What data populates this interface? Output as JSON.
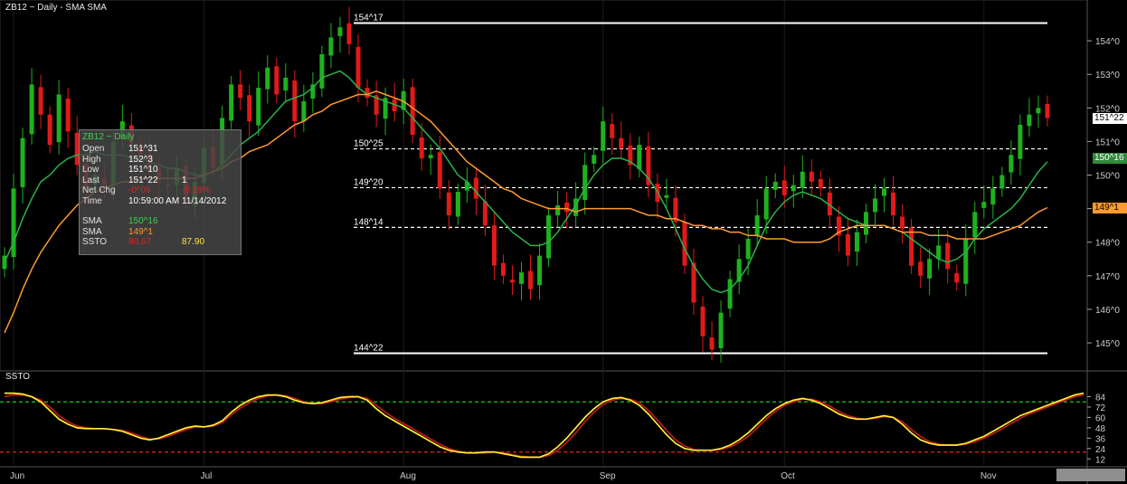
{
  "header": {
    "title": "ZB12 ~ Daily  -  SMA SMA"
  },
  "info_panel": {
    "header": "ZB12 ~ Daily",
    "rows": [
      {
        "label": "Open",
        "value": "151^31",
        "value2": ""
      },
      {
        "label": "High",
        "value": "152^3",
        "value2": ""
      },
      {
        "label": "Low",
        "value": "151^10",
        "value2": ""
      },
      {
        "label": "Last",
        "value": "151^22",
        "value2": "1"
      },
      {
        "label": "Net Chg",
        "value": "-0^09",
        "value2": "-0.19%"
      },
      {
        "label": "Time",
        "value": "10:59:00 AM",
        "value2": "11/14/2012"
      }
    ],
    "indicators": [
      {
        "label": "SMA",
        "value": "150^16",
        "value2": "",
        "color": "#3fd14f"
      },
      {
        "label": "SMA",
        "value": "149^1",
        "value2": "",
        "color": "#ff9a2e"
      },
      {
        "label": "SSTO",
        "value": "80.67",
        "value2": "87.90",
        "color": "#e02020",
        "color2": "#ffe14a"
      }
    ]
  },
  "price_badges": [
    {
      "text": "151^22",
      "bg": "#ffffff",
      "fg": "#000000",
      "value": 151.6875
    },
    {
      "text": "150^16",
      "bg": "#2e8b3a",
      "fg": "#ffffff",
      "value": 150.5
    },
    {
      "text": "149^1",
      "bg": "#ff9a2e",
      "fg": "#000000",
      "value": 149.03
    }
  ],
  "ssto_label": "SSTO",
  "colors": {
    "up": "#1db21d",
    "down": "#e01a1a",
    "sma_fast": "#2bb24a",
    "sma_slow": "#ff9a2e",
    "ssto_k": "#ffee33",
    "ssto_d": "#c01818",
    "upper_band": "#22dd22",
    "lower_band": "#dd2222"
  },
  "chart_data": [
    {
      "type": "candlestick",
      "title": "ZB12 ~ Daily  -  SMA SMA",
      "ylim": [
        144.3,
        155
      ],
      "y_ticks": [
        "145^0",
        "146^0",
        "147^0",
        "148^0",
        "149^0",
        "150^0",
        "151^0",
        "152^0",
        "153^0",
        "154^0"
      ],
      "x_labels": [
        {
          "label": "Jun",
          "index": 1
        },
        {
          "label": "Jul",
          "index": 22
        },
        {
          "label": "Aug",
          "index": 44
        },
        {
          "label": "Sep",
          "index": 66
        },
        {
          "label": "Oct",
          "index": 86
        },
        {
          "label": "Nov",
          "index": 108
        }
      ],
      "levels": [
        {
          "label": "154^17",
          "value": 154.53,
          "style": "solid",
          "x_start_index": 39
        },
        {
          "label": "150^25",
          "value": 150.78,
          "style": "dashed",
          "x_start_index": 39
        },
        {
          "label": "149^20",
          "value": 149.625,
          "style": "dashed",
          "x_start_index": 39
        },
        {
          "label": "148^14",
          "value": 148.44,
          "style": "dashed",
          "x_start_index": 39
        },
        {
          "label": "144^22",
          "value": 144.69,
          "style": "solid",
          "x_start_index": 39
        }
      ],
      "ohlc_close": [
        147.6,
        149.6,
        151.1,
        152.7,
        151.8,
        150.9,
        152.4,
        151.3,
        150.3,
        149.6,
        150.0,
        149.7,
        151.0,
        151.6,
        150.9,
        150.6,
        150.1,
        149.8,
        149.7,
        150.2,
        149.2,
        149.8,
        150.8,
        150.2,
        151.7,
        152.7,
        152.3,
        151.6,
        152.6,
        153.2,
        152.4,
        152.9,
        151.6,
        152.2,
        152.7,
        153.6,
        154.1,
        154.4,
        153.9,
        152.6,
        152.3,
        151.8,
        152.3,
        151.9,
        152.5,
        151.2,
        150.5,
        150.6,
        149.6,
        148.8,
        149.5,
        149.8,
        149.3,
        148.5,
        147.3,
        147.0,
        146.8,
        147.1,
        146.6,
        147.6,
        148.8,
        149.1,
        148.9,
        149.3,
        150.3,
        150.6,
        151.6,
        151.1,
        150.8,
        150.3,
        150.9,
        149.7,
        149.2,
        149.4,
        148.6,
        147.3,
        146.2,
        145.2,
        144.8,
        145.9,
        146.9,
        147.5,
        148.1,
        148.8,
        149.6,
        149.8,
        149.4,
        149.7,
        150.1,
        149.8,
        149.6,
        148.8,
        148.2,
        147.6,
        148.3,
        148.9,
        149.3,
        149.6,
        148.8,
        148.4,
        147.3,
        147.0,
        147.5,
        147.9,
        147.2,
        146.8,
        148.1,
        148.9,
        149.2,
        149.6,
        150.0,
        150.6,
        151.5,
        151.8,
        152.0,
        151.7
      ],
      "series": [
        {
          "name": "SMA",
          "values": [
            147.4,
            148.0,
            148.7,
            149.3,
            149.8,
            150.0,
            150.3,
            150.5,
            150.6,
            150.6,
            150.7,
            150.6,
            150.6,
            150.6,
            150.5,
            150.5,
            150.4,
            150.3,
            150.2,
            150.2,
            150.1,
            150.0,
            150.0,
            150.1,
            150.3,
            150.6,
            150.9,
            151.1,
            151.3,
            151.6,
            151.9,
            152.2,
            152.3,
            152.4,
            152.6,
            152.9,
            153.0,
            153.1,
            152.9,
            152.6,
            152.4,
            152.3,
            152.2,
            152.1,
            152.0,
            151.7,
            151.4,
            151.1,
            150.8,
            150.4,
            150.0,
            149.8,
            149.5,
            149.2,
            148.9,
            148.6,
            148.3,
            148.1,
            147.9,
            147.9,
            148.0,
            148.3,
            148.7,
            149.1,
            149.6,
            150.0,
            150.3,
            150.5,
            150.5,
            150.4,
            150.2,
            149.9,
            149.5,
            149.0,
            148.4,
            147.8,
            147.3,
            146.9,
            146.6,
            146.5,
            146.6,
            146.9,
            147.3,
            147.9,
            148.5,
            148.9,
            149.2,
            149.4,
            149.5,
            149.4,
            149.3,
            149.1,
            148.9,
            148.7,
            148.6,
            148.5,
            148.5,
            148.5,
            148.4,
            148.3,
            148.1,
            147.9,
            147.7,
            147.5,
            147.4,
            147.5,
            147.7,
            148.1,
            148.4,
            148.6,
            148.8,
            149.0,
            149.3,
            149.7,
            150.1,
            150.4
          ]
        },
        {
          "name": "SMA",
          "values": [
            145.3,
            145.9,
            146.6,
            147.2,
            147.7,
            148.1,
            148.5,
            148.8,
            149.1,
            149.3,
            149.5,
            149.6,
            149.7,
            149.8,
            149.8,
            149.9,
            149.9,
            149.9,
            149.9,
            149.9,
            149.9,
            149.9,
            150.0,
            150.1,
            150.2,
            150.4,
            150.5,
            150.7,
            150.8,
            150.9,
            151.1,
            151.3,
            151.5,
            151.6,
            151.8,
            151.9,
            152.1,
            152.2,
            152.3,
            152.4,
            152.4,
            152.5,
            152.4,
            152.3,
            152.2,
            152.0,
            151.8,
            151.6,
            151.3,
            151.0,
            150.7,
            150.4,
            150.2,
            150.0,
            149.8,
            149.6,
            149.5,
            149.3,
            149.2,
            149.1,
            149.0,
            149.0,
            149.0,
            148.9,
            149.0,
            149.0,
            149.0,
            149.0,
            149.0,
            149.0,
            148.9,
            148.8,
            148.8,
            148.7,
            148.7,
            148.6,
            148.5,
            148.5,
            148.4,
            148.4,
            148.3,
            148.3,
            148.2,
            148.2,
            148.1,
            148.1,
            148.1,
            148.0,
            148.0,
            148.0,
            148.0,
            148.1,
            148.3,
            148.4,
            148.5,
            148.5,
            148.5,
            148.5,
            148.4,
            148.3,
            148.3,
            148.3,
            148.2,
            148.2,
            148.2,
            148.1,
            148.1,
            148.1,
            148.1,
            148.2,
            148.3,
            148.4,
            148.5,
            148.7,
            148.9,
            149.03
          ]
        }
      ]
    },
    {
      "type": "line",
      "title": "SSTO",
      "ylim": [
        6,
        96
      ],
      "y_ticks": [
        12,
        24,
        36,
        48,
        60,
        72,
        84
      ],
      "reference_lines": [
        78,
        20
      ],
      "series": [
        {
          "name": "SSTO",
          "values": [
            88,
            88,
            87,
            84,
            78,
            68,
            58,
            52,
            48,
            47,
            47,
            47,
            46,
            44,
            40,
            36,
            34,
            36,
            40,
            44,
            48,
            50,
            49,
            51,
            56,
            66,
            74,
            80,
            84,
            86,
            86,
            84,
            80,
            77,
            76,
            77,
            80,
            83,
            84,
            84,
            80,
            70,
            62,
            56,
            50,
            44,
            38,
            32,
            26,
            22,
            20,
            19,
            19,
            20,
            20,
            18,
            16,
            14,
            14,
            14,
            18,
            26,
            36,
            48,
            60,
            70,
            78,
            82,
            83,
            80,
            74,
            64,
            52,
            40,
            30,
            24,
            22,
            22,
            22,
            24,
            28,
            34,
            42,
            52,
            62,
            70,
            76,
            80,
            82,
            80,
            76,
            70,
            64,
            60,
            58,
            58,
            60,
            62,
            60,
            52,
            42,
            34,
            30,
            28,
            28,
            28,
            30,
            34,
            38,
            44,
            50,
            56,
            62,
            66,
            70,
            74,
            78,
            82,
            86,
            88
          ]
        },
        {
          "name": "SSTO",
          "values": [
            84,
            86,
            86,
            84,
            80,
            72,
            62,
            55,
            50,
            48,
            47,
            47,
            46,
            45,
            42,
            38,
            35,
            35,
            38,
            42,
            46,
            49,
            49,
            50,
            54,
            63,
            71,
            77,
            82,
            85,
            86,
            85,
            82,
            78,
            76,
            76,
            78,
            81,
            83,
            84,
            82,
            74,
            66,
            59,
            53,
            47,
            41,
            35,
            29,
            24,
            21,
            19,
            19,
            19,
            20,
            19,
            17,
            15,
            14,
            14,
            16,
            22,
            31,
            42,
            55,
            66,
            75,
            80,
            82,
            81,
            77,
            68,
            57,
            45,
            34,
            27,
            23,
            22,
            22,
            23,
            26,
            31,
            38,
            48,
            58,
            67,
            74,
            78,
            81,
            81,
            78,
            73,
            67,
            62,
            59,
            58,
            59,
            61,
            60,
            55,
            46,
            38,
            32,
            29,
            28,
            28,
            29,
            32,
            36,
            41,
            47,
            53,
            59,
            64,
            68,
            72,
            76,
            80,
            84,
            86
          ]
        }
      ]
    }
  ]
}
